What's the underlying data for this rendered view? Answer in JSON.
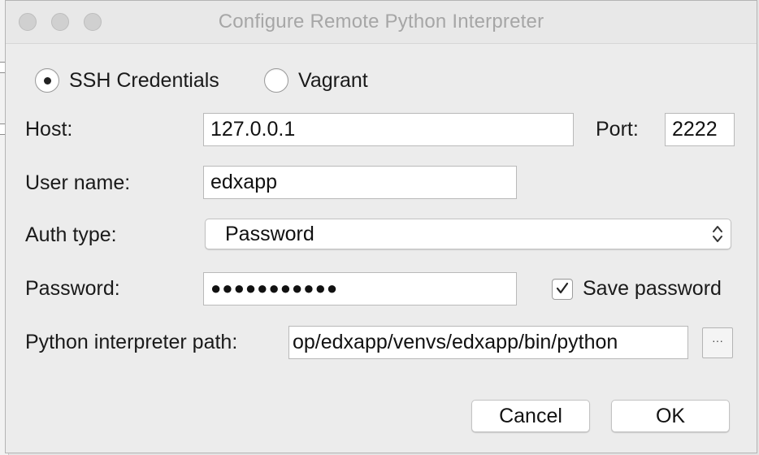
{
  "window": {
    "title": "Configure Remote Python Interpreter"
  },
  "connection_type": {
    "options": [
      {
        "label": "SSH Credentials",
        "selected": true
      },
      {
        "label": "Vagrant",
        "selected": false
      }
    ]
  },
  "form": {
    "host_label": "Host:",
    "host_value": "127.0.0.1",
    "port_label": "Port:",
    "port_value": "2222",
    "username_label": "User name:",
    "username_value": "edxapp",
    "auth_type_label": "Auth type:",
    "auth_type_value": "Password",
    "password_label": "Password:",
    "password_value": "●●●●●●●●●●●",
    "save_password_label": "Save password",
    "save_password_checked": true,
    "interpreter_path_label": "Python interpreter path:",
    "interpreter_path_value": "op/edxapp/venvs/edxapp/bin/python",
    "browse_label": "···"
  },
  "buttons": {
    "cancel": "Cancel",
    "ok": "OK"
  },
  "icons": {
    "radio_selected": "radio-selected-icon",
    "radio_unselected": "radio-unselected-icon",
    "select_chevrons": "up-down-chevron-icon",
    "checkbox_check": "checkmark-icon"
  }
}
